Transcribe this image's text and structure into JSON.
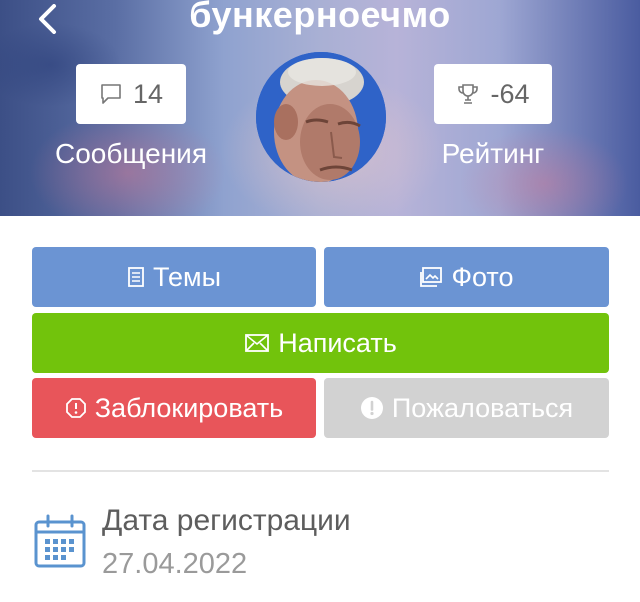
{
  "header": {
    "username": "бункерноечмо",
    "messages": {
      "count": "14",
      "label": "Сообщения",
      "icon": "speech-bubble-icon"
    },
    "rating": {
      "value": "-64",
      "label": "Рейтинг",
      "icon": "trophy-icon"
    }
  },
  "buttons": {
    "topics": {
      "label": "Темы",
      "icon": "document-icon"
    },
    "photo": {
      "label": "Фото",
      "icon": "photo-icon"
    },
    "write": {
      "label": "Написать",
      "icon": "envelope-icon"
    },
    "block": {
      "label": "Заблокировать",
      "icon": "octagon-alert-icon"
    },
    "report": {
      "label": "Пожаловаться",
      "icon": "exclamation-circle-icon"
    }
  },
  "registration": {
    "label": "Дата регистрации",
    "date": "27.04.2022",
    "icon": "calendar-icon"
  },
  "colors": {
    "primary_blue": "#6b94d3",
    "green": "#72c30c",
    "red": "#e8555a",
    "disabled_gray": "#d2d2d2",
    "icon_blue": "#5a93cf"
  }
}
